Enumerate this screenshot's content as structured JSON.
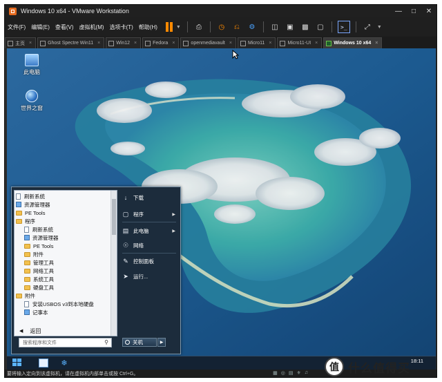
{
  "window": {
    "title": "Windows 10 x64 - VMware Workstation"
  },
  "menubar": {
    "items": [
      "文件(F)",
      "编辑(E)",
      "查看(V)",
      "虚拟机(M)",
      "选项卡(T)",
      "帮助(H)"
    ]
  },
  "tabs": [
    {
      "label": "主页",
      "active": false
    },
    {
      "label": "Ghost Spectre Win11",
      "active": false
    },
    {
      "label": "Win12",
      "active": false
    },
    {
      "label": "Fedora",
      "active": false
    },
    {
      "label": "openmediavault",
      "active": false
    },
    {
      "label": "Micro11",
      "active": false
    },
    {
      "label": "Micro11-UI",
      "active": false
    },
    {
      "label": "Windows 10 x64",
      "active": true
    }
  ],
  "desktop": {
    "icons": [
      {
        "label": "此电脑",
        "icon": "computer-icon"
      },
      {
        "label": "世界之窗",
        "icon": "globe-browser-icon"
      }
    ]
  },
  "start_menu": {
    "left_items": [
      {
        "label": "刷新系统",
        "kind": "doc",
        "indent": 0
      },
      {
        "label": "资源管理器",
        "kind": "app",
        "indent": 0
      },
      {
        "label": "PE Tools",
        "kind": "folder",
        "indent": 0
      },
      {
        "label": "程序",
        "kind": "folder",
        "indent": 0
      },
      {
        "label": "刷新系统",
        "kind": "doc",
        "indent": 1
      },
      {
        "label": "资源管理器",
        "kind": "app",
        "indent": 1
      },
      {
        "label": "PE Tools",
        "kind": "folder",
        "indent": 1
      },
      {
        "label": "附件",
        "kind": "folder",
        "indent": 1
      },
      {
        "label": "管理工具",
        "kind": "folder",
        "indent": 1
      },
      {
        "label": "网络工具",
        "kind": "folder",
        "indent": 1
      },
      {
        "label": "系统工具",
        "kind": "folder",
        "indent": 1
      },
      {
        "label": "硬盘工具",
        "kind": "folder",
        "indent": 1
      },
      {
        "label": "附件",
        "kind": "folder",
        "indent": 0
      },
      {
        "label": "安装USBOS v3到本地硬盘",
        "kind": "doc",
        "indent": 1
      },
      {
        "label": "记事本",
        "kind": "app",
        "indent": 1
      }
    ],
    "back_label": "返回",
    "search_placeholder": "搜索程序和文件",
    "right_items": [
      {
        "label": "下载",
        "icon": "download-icon",
        "arrow": false
      },
      {
        "label": "程序",
        "icon": "programs-icon",
        "arrow": true
      },
      {
        "label": "此电脑",
        "icon": "computer-icon",
        "arrow": true
      },
      {
        "label": "网络",
        "icon": "network-icon",
        "arrow": false
      },
      {
        "label": "控制面板",
        "icon": "control-panel-icon",
        "arrow": false
      },
      {
        "label": "运行...",
        "icon": "run-icon",
        "arrow": false
      }
    ],
    "shutdown_label": "关机"
  },
  "taskbar": {
    "clock": "18:11"
  },
  "statusbar": {
    "text": "要将输入定向到该虚拟机，请在虚拟机内部单击或按 Ctrl+G。"
  },
  "watermark": {
    "logo_char": "值",
    "text": "什么值得买"
  },
  "colors": {
    "accent_orange": "#ff8a00",
    "active_tab_icon": "#6cc24a",
    "start_menu_bg": "#1c2c3c"
  }
}
